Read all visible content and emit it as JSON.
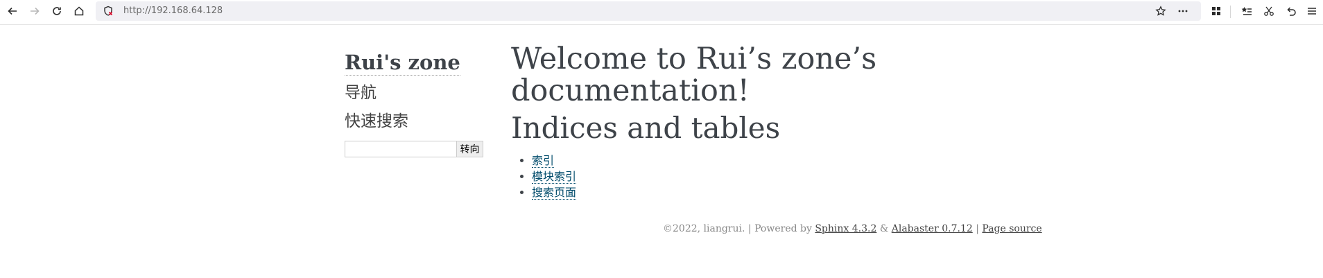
{
  "browser": {
    "url": "http://192.168.64.128",
    "icons": [
      "back-arrow-icon",
      "forward-arrow-icon",
      "reload-icon",
      "home-icon",
      "shield-warning-icon",
      "star-icon",
      "more-icon",
      "extensions-icon",
      "bookmarks-list-icon",
      "scissors-icon",
      "undo-icon",
      "menu-icon"
    ]
  },
  "sidebar": {
    "logo": "Rui's zone",
    "nav_heading": "导航",
    "search_heading": "快速搜索",
    "search_value": "",
    "search_button": "转向"
  },
  "main": {
    "title": "Welcome to Rui’s zone’s documentation!",
    "section": "Indices and tables",
    "links": [
      "索引",
      "模块索引",
      "搜索页面"
    ]
  },
  "footer": {
    "copyright": "©2022, liangrui.",
    "sep1": " | Powered by ",
    "sphinx": "Sphinx 4.3.2",
    "amp": " & ",
    "alabaster": "Alabaster 0.7.12",
    "sep2": " | ",
    "page_source": "Page source"
  },
  "colors": {
    "link": "#004b6b",
    "text": "#3e4349",
    "urlbar": "#f0f0f4"
  }
}
